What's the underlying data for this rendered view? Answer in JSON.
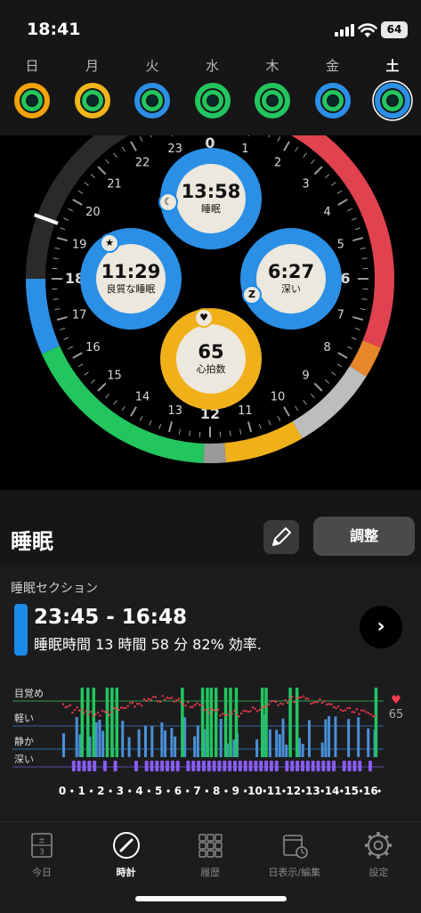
{
  "status": {
    "time": "18:41",
    "battery": "64"
  },
  "days": [
    {
      "label": "日",
      "outer": "#f0a30a",
      "inner": "#22c55e",
      "active": false
    },
    {
      "label": "月",
      "outer": "#f0b51a",
      "inner": "#22c55e",
      "active": false
    },
    {
      "label": "火",
      "outer": "#2b8fe6",
      "inner": "#22c55e",
      "active": false
    },
    {
      "label": "水",
      "outer": "#22c55e",
      "inner": "#22c55e",
      "active": false
    },
    {
      "label": "木",
      "outer": "#22c55e",
      "inner": "#22c55e",
      "active": false
    },
    {
      "label": "金",
      "outer": "#2b8fe6",
      "inner": "#22c55e",
      "active": false
    },
    {
      "label": "土",
      "outer": "#2b8fe6",
      "inner": "#22c55e",
      "active": true
    }
  ],
  "clock": {
    "hour_labels": [
      "12",
      "13",
      "14",
      "15",
      "16",
      "17",
      "18",
      "19",
      "20",
      "21",
      "22",
      "23",
      "0",
      "1",
      "2",
      "3",
      "4",
      "5",
      "6",
      "7",
      "8",
      "9",
      "10",
      "11"
    ],
    "bubbles": {
      "sleep": {
        "value": "13:58",
        "label": "睡眠"
      },
      "quality": {
        "value": "11:29",
        "label": "良質な睡眠"
      },
      "deep": {
        "value": "6:27",
        "label": "深い"
      },
      "hr": {
        "value": "65",
        "label": "心拍数"
      }
    },
    "badges": {
      "deep": "Z"
    }
  },
  "section": {
    "title": "睡眠",
    "adjust_label": "調整"
  },
  "session": {
    "label": "睡眠セクション",
    "time_range": "23:45 - 16:48",
    "summary": "睡眠時間 13 時間 58 分 82% 効率."
  },
  "hypnogram": {
    "levels": [
      "目覚め",
      "軽い",
      "静か",
      "深い"
    ],
    "hours": [
      "0",
      "1",
      "2",
      "3",
      "4",
      "5",
      "6",
      "7",
      "8",
      "9",
      "10",
      "11",
      "12",
      "13",
      "14",
      "15",
      "16"
    ],
    "hr_value": "65",
    "colors": {
      "awake": "#22c55e",
      "light": "#4a90d9",
      "deep": "#8b5cf6",
      "hr": "#ff3b4f"
    },
    "awake_spikes": [
      0.95,
      1.25,
      1.55,
      2.25,
      2.5,
      2.75,
      6.15,
      7.2,
      7.45,
      7.65,
      7.9,
      8.4,
      8.65,
      8.95,
      10.3,
      10.5,
      11.75,
      12.1,
      16.2
    ]
  },
  "tabs": [
    {
      "label": "今日",
      "icon": "calendar-day-icon",
      "active": false
    },
    {
      "label": "時計",
      "icon": "clock-icon",
      "active": true
    },
    {
      "label": "履歴",
      "icon": "grid-icon",
      "active": false
    },
    {
      "label": "日表示/編集",
      "icon": "calendar-edit-icon",
      "active": false
    },
    {
      "label": "設定",
      "icon": "gear-icon",
      "active": false
    }
  ]
}
